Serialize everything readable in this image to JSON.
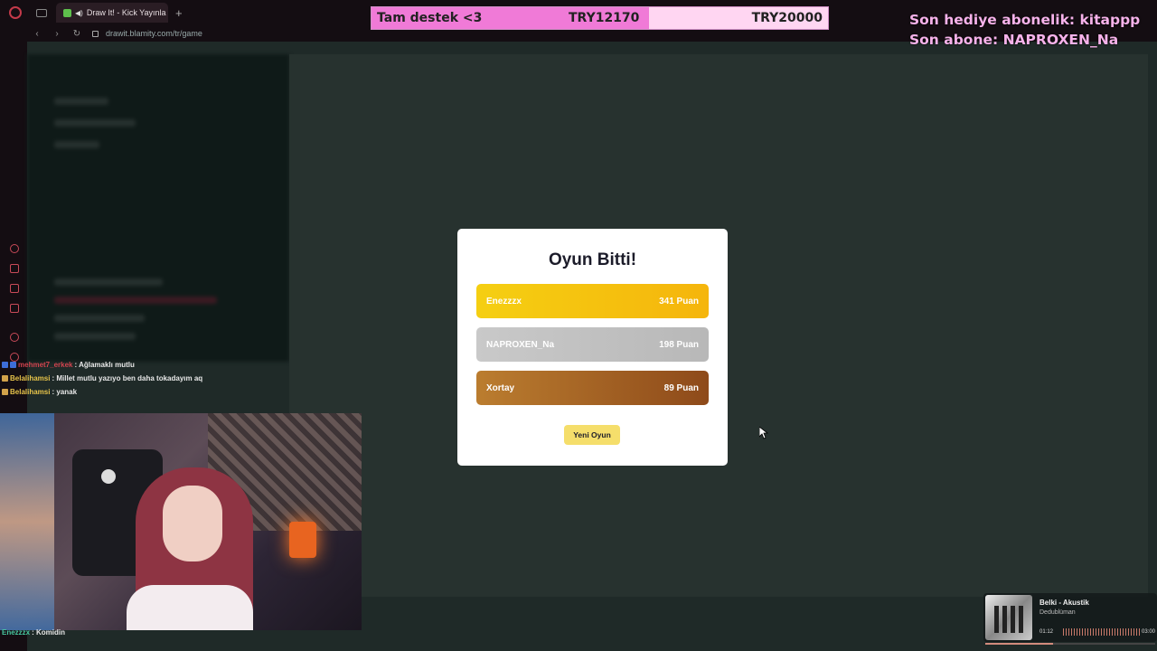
{
  "browser": {
    "tab_title": "Draw It! - Kick Yayınla",
    "url": "drawit.blamity.com/tr/game",
    "new_tab_symbol": "+"
  },
  "overlay": {
    "goal_title": "Tam destek <3",
    "goal_current": "TRY12170",
    "goal_target": "TRY20000",
    "goal_progress_fraction": 0.6085,
    "last_gift_sub": "Son hediye abonelik: kitappp",
    "last_sub": "Son abone: NAPROXEN_Na"
  },
  "chat": [
    {
      "user": "mehmet7_erkek",
      "user_color": "#d0434e",
      "message": ": Ağlamaklı mutlu"
    },
    {
      "user": "Belalihamsi",
      "user_color": "#e6c34a",
      "message": ": Millet mutlu yazıyo ben daha tokadayım aq"
    },
    {
      "user": "Belalihamsi",
      "user_color": "#e6c34a",
      "message": ": yanak"
    }
  ],
  "chat_bottom": [
    {
      "user": "Enezzzx",
      "user_color": "#47c8a0",
      "message": ": Komidin"
    }
  ],
  "modal": {
    "title": "Oyun Bitti!",
    "scores": [
      {
        "name": "Enezzzx",
        "points": "341 Puan",
        "rank": "gold"
      },
      {
        "name": "NAPROXEN_Na",
        "points": "198 Puan",
        "rank": "silver"
      },
      {
        "name": "Xortay",
        "points": "89 Puan",
        "rank": "bronze"
      }
    ],
    "new_game_label": "Yeni Oyun"
  },
  "music": {
    "title": "Belki - Akustik",
    "artist": "Dedublüman",
    "elapsed": "01:12",
    "total": "03:00",
    "progress_fraction": 0.4
  },
  "colors": {
    "accent_red": "#c84a58",
    "goal_pink": "#f07ad7",
    "modal_gold": "#f5c20f",
    "modal_silver": "#c0c0c0",
    "modal_bronze": "#a5652a",
    "button_yellow": "#f5de6b"
  }
}
